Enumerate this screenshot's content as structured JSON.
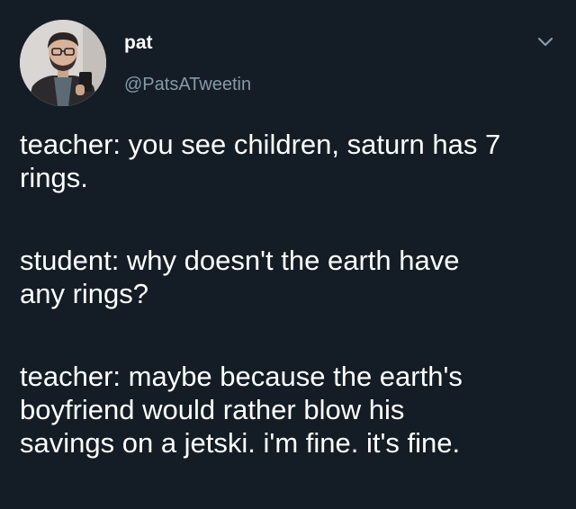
{
  "tweet": {
    "author_name": "pat",
    "author_handle": "@PatsATweetin",
    "menu_icon": "chevron-down-icon",
    "paragraphs": [
      [
        "teacher: you see children, saturn has 7",
        "rings."
      ],
      [
        "student: why doesn't the earth have",
        "any rings?"
      ],
      [
        "teacher: maybe because the earth's",
        "boyfriend would rather blow his",
        "savings on a jetski. i'm fine. it's fine."
      ]
    ]
  },
  "colors": {
    "background": "#141d26",
    "text": "#ffffff",
    "secondary_text": "#8899a6"
  }
}
